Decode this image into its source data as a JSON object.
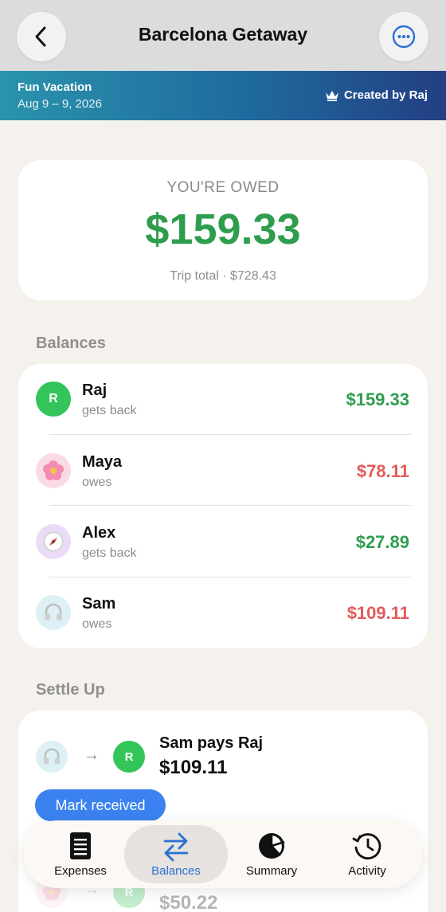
{
  "header": {
    "title": "Barcelona Getaway",
    "back_icon": "chevron-left-icon",
    "more_icon": "more-horizontal-circle-icon"
  },
  "banner": {
    "trip_type": "Fun Vacation",
    "dates": "Aug 9 – 9, 2026",
    "creator": "Created by Raj",
    "creator_icon": "crown-icon"
  },
  "summary": {
    "label": "YOU'RE OWED",
    "amount": "$159.33",
    "trip_total": "Trip total · $728.43"
  },
  "balances": {
    "title": "Balances",
    "items": [
      {
        "name": "Raj",
        "status": "gets back",
        "amount": "$159.33",
        "avatar": "R",
        "tone": "positive"
      },
      {
        "name": "Maya",
        "status": "owes",
        "amount": "$78.11",
        "avatar": "flower-emoji",
        "tone": "negative"
      },
      {
        "name": "Alex",
        "status": "gets back",
        "amount": "$27.89",
        "avatar": "compass-emoji",
        "tone": "positive"
      },
      {
        "name": "Sam",
        "status": "owes",
        "amount": "$109.11",
        "avatar": "headphones-emoji",
        "tone": "negative"
      }
    ]
  },
  "settle": {
    "title": "Settle Up",
    "items": [
      {
        "from_avatar": "headphones-emoji",
        "to_avatar": "R",
        "text": "Sam pays Raj",
        "amount": "$109.11",
        "button": "Mark received"
      },
      {
        "from_avatar": "flower-emoji",
        "to_avatar": "R",
        "amount": "$50.22"
      }
    ]
  },
  "tabs": [
    {
      "label": "Expenses",
      "icon": "notebook-icon",
      "active": false
    },
    {
      "label": "Balances",
      "icon": "arrows-swap-icon",
      "active": true
    },
    {
      "label": "Summary",
      "icon": "pie-chart-icon",
      "active": false
    },
    {
      "label": "Activity",
      "icon": "clock-history-icon",
      "active": false
    }
  ],
  "colors": {
    "positive": "#2e9e4e",
    "negative": "#e25b5b",
    "accent": "#3b82f0",
    "banner_start": "#2a93ac",
    "banner_end": "#233f84"
  }
}
